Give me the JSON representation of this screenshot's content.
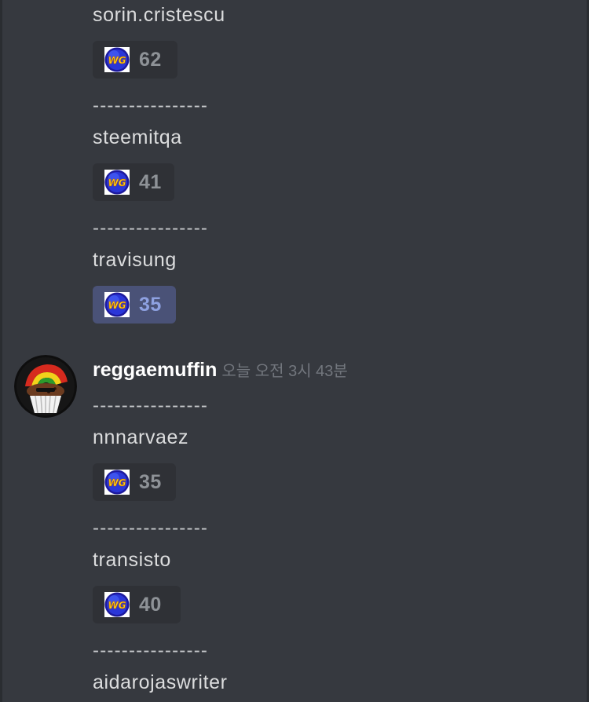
{
  "messages": [
    {
      "lines": [
        "sorin.cristescu"
      ],
      "reaction": {
        "emoji": "wg-emoji-icon",
        "count": "62",
        "active": false
      }
    },
    {
      "lines": [
        "----------------",
        "steemitqa"
      ],
      "reaction": {
        "emoji": "wg-emoji-icon",
        "count": "41",
        "active": false
      }
    },
    {
      "lines": [
        "----------------",
        "travisung"
      ],
      "reaction": {
        "emoji": "wg-emoji-icon",
        "count": "35",
        "active": true
      }
    }
  ],
  "post": {
    "author": "reggaemuffin",
    "timestamp": "오늘 오전 3시 43분",
    "avatar": "muffin-rasta-avatar",
    "blocks": [
      {
        "lines": [
          "----------------",
          "nnnarvaez"
        ],
        "reaction": {
          "emoji": "wg-emoji-icon",
          "count": "35",
          "active": false
        }
      },
      {
        "lines": [
          "----------------",
          "transisto"
        ],
        "reaction": {
          "emoji": "wg-emoji-icon",
          "count": "40",
          "active": false
        }
      },
      {
        "lines": [
          "----------------",
          "aidarojaswriter"
        ]
      }
    ]
  },
  "colors": {
    "background": "#36393f",
    "reaction_bg": "#2f3136",
    "reaction_active_bg": "#4a5277",
    "reaction_active_count": "#8ea1e1",
    "username": "#ffffff",
    "timestamp": "#72767d"
  }
}
